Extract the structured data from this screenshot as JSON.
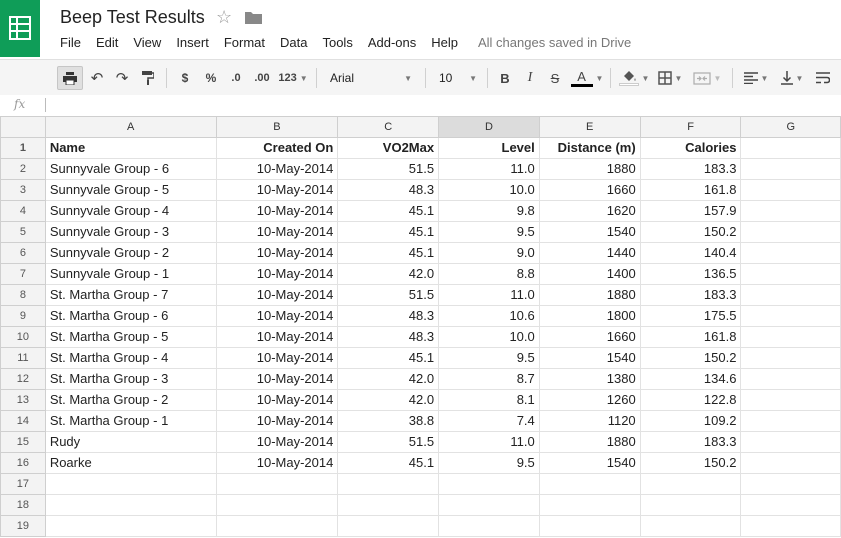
{
  "doc": {
    "title": "Beep Test Results",
    "save_status": "All changes saved in Drive"
  },
  "menu": [
    "File",
    "Edit",
    "View",
    "Insert",
    "Format",
    "Data",
    "Tools",
    "Add-ons",
    "Help"
  ],
  "toolbar": {
    "currency": "$",
    "percent": "%",
    "decrease_decimals": ".0",
    "increase_decimals": ".00",
    "more_formats": "123",
    "font": "Arial",
    "font_size": "10",
    "bold": "B",
    "italic": "I",
    "strike": "S",
    "text_color": "A"
  },
  "formula_bar": {
    "fx_label": "fx",
    "value": ""
  },
  "columns": [
    "A",
    "B",
    "C",
    "D",
    "E",
    "F",
    "G"
  ],
  "rows": [
    {
      "num": "1",
      "cells": [
        "Name",
        "Created On",
        "VO2Max",
        "Level",
        "Distance (m)",
        "Calories",
        ""
      ]
    },
    {
      "num": "2",
      "cells": [
        "Sunnyvale Group - 6",
        "10-May-2014",
        "51.5",
        "11.0",
        "1880",
        "183.3",
        ""
      ]
    },
    {
      "num": "3",
      "cells": [
        "Sunnyvale Group - 5",
        "10-May-2014",
        "48.3",
        "10.0",
        "1660",
        "161.8",
        ""
      ]
    },
    {
      "num": "4",
      "cells": [
        "Sunnyvale Group - 4",
        "10-May-2014",
        "45.1",
        "9.8",
        "1620",
        "157.9",
        ""
      ]
    },
    {
      "num": "5",
      "cells": [
        "Sunnyvale Group - 3",
        "10-May-2014",
        "45.1",
        "9.5",
        "1540",
        "150.2",
        ""
      ]
    },
    {
      "num": "6",
      "cells": [
        "Sunnyvale Group - 2",
        "10-May-2014",
        "45.1",
        "9.0",
        "1440",
        "140.4",
        ""
      ]
    },
    {
      "num": "7",
      "cells": [
        "Sunnyvale Group - 1",
        "10-May-2014",
        "42.0",
        "8.8",
        "1400",
        "136.5",
        ""
      ]
    },
    {
      "num": "8",
      "cells": [
        "St. Martha Group - 7",
        "10-May-2014",
        "51.5",
        "11.0",
        "1880",
        "183.3",
        ""
      ]
    },
    {
      "num": "9",
      "cells": [
        "St. Martha Group - 6",
        "10-May-2014",
        "48.3",
        "10.6",
        "1800",
        "175.5",
        ""
      ]
    },
    {
      "num": "10",
      "cells": [
        "St. Martha Group - 5",
        "10-May-2014",
        "48.3",
        "10.0",
        "1660",
        "161.8",
        ""
      ]
    },
    {
      "num": "11",
      "cells": [
        "St. Martha Group - 4",
        "10-May-2014",
        "45.1",
        "9.5",
        "1540",
        "150.2",
        ""
      ]
    },
    {
      "num": "12",
      "cells": [
        "St. Martha Group - 3",
        "10-May-2014",
        "42.0",
        "8.7",
        "1380",
        "134.6",
        ""
      ]
    },
    {
      "num": "13",
      "cells": [
        "St. Martha Group - 2",
        "10-May-2014",
        "42.0",
        "8.1",
        "1260",
        "122.8",
        ""
      ]
    },
    {
      "num": "14",
      "cells": [
        "St. Martha Group - 1",
        "10-May-2014",
        "38.8",
        "7.4",
        "1120",
        "109.2",
        ""
      ]
    },
    {
      "num": "15",
      "cells": [
        "Rudy",
        "10-May-2014",
        "51.5",
        "11.0",
        "1880",
        "183.3",
        ""
      ]
    },
    {
      "num": "16",
      "cells": [
        "Roarke",
        "10-May-2014",
        "45.1",
        "9.5",
        "1540",
        "150.2",
        ""
      ]
    },
    {
      "num": "17",
      "cells": [
        "",
        "",
        "",
        "",
        "",
        "",
        ""
      ]
    },
    {
      "num": "18",
      "cells": [
        "",
        "",
        "",
        "",
        "",
        "",
        ""
      ]
    },
    {
      "num": "19",
      "cells": [
        "",
        "",
        "",
        "",
        "",
        "",
        ""
      ]
    }
  ],
  "selected_column": "D",
  "colors": {
    "brand": "#0f9d58",
    "text_color_bar": "#000000"
  }
}
